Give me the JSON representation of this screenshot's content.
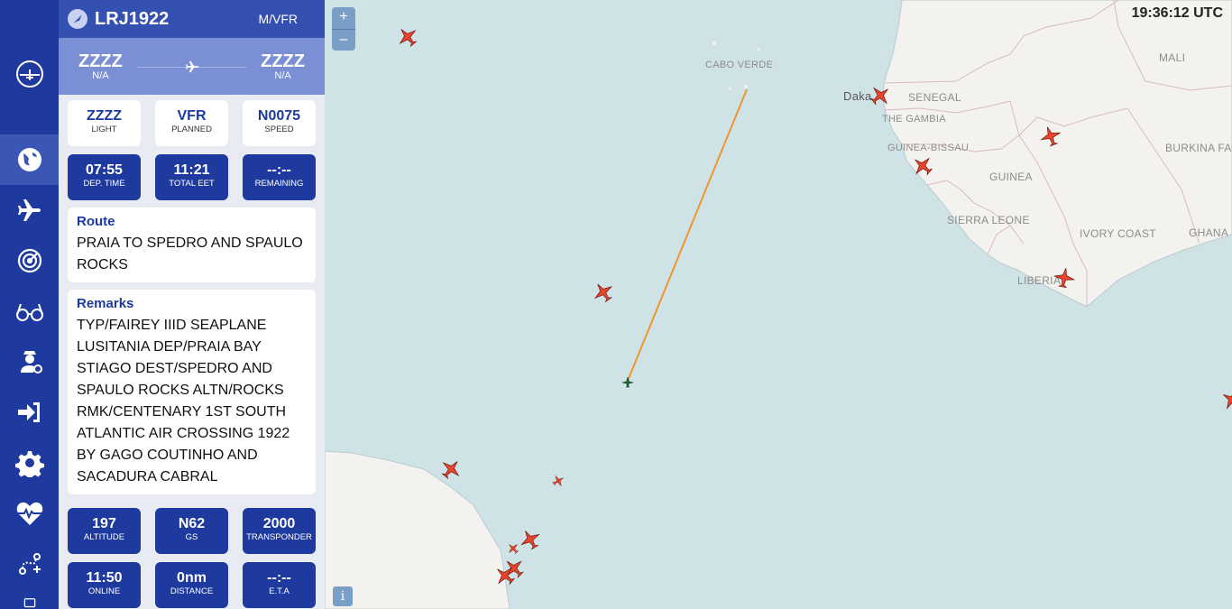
{
  "nav": {
    "items": [
      "logo-icon",
      "globe-icon",
      "airplane-icon",
      "radar-icon",
      "glasses-icon",
      "pilot-icon",
      "login-icon",
      "gear-icon",
      "heart-pulse-icon",
      "route-icon"
    ],
    "active": "globe-icon"
  },
  "flight": {
    "callsign": "LRJ1922",
    "rules": "M/VFR",
    "departure": {
      "code": "ZZZZ",
      "name": "N/A"
    },
    "arrival": {
      "code": "ZZZZ",
      "name": "N/A"
    },
    "row1": [
      {
        "value": "ZZZZ",
        "label": "LIGHT"
      },
      {
        "value": "VFR",
        "label": "PLANNED"
      },
      {
        "value": "N0075",
        "label": "SPEED"
      }
    ],
    "row2": [
      {
        "value": "07:55",
        "label": "DEP. TIME"
      },
      {
        "value": "11:21",
        "label": "TOTAL EET"
      },
      {
        "value": "--:--",
        "label": "REMAINING"
      }
    ],
    "route_title": "Route",
    "route_text": "PRAIA TO SPEDRO AND SPAULO ROCKS",
    "remarks_title": "Remarks",
    "remarks_text": "TYP/FAIREY IIID SEAPLANE LUSITANIA DEP/PRAIA BAY STIAGO DEST/SPEDRO AND SPAULO ROCKS ALTN/ROCKS RMK/CENTENARY 1ST SOUTH ATLANTIC AIR CROSSING 1922 BY GAGO COUTINHO AND SACADURA CABRAL",
    "row3": [
      {
        "value": "197",
        "label": "ALTITUDE"
      },
      {
        "value": "N62",
        "label": "GS"
      },
      {
        "value": "2000",
        "label": "TRANSPONDER"
      }
    ],
    "row4": [
      {
        "value": "11:50",
        "label": "ONLINE"
      },
      {
        "value": "0nm",
        "label": "DISTANCE"
      },
      {
        "value": "--:--",
        "label": "E.T.A"
      }
    ]
  },
  "map": {
    "clock": "19:36:12 UTC",
    "zoom_in": "+",
    "zoom_out": "–",
    "info": "i",
    "labels": {
      "cabo_verde": "CABO VERDE",
      "dakar": "Daka",
      "senegal": "SENEGAL",
      "the_gambia": "THE GAMBIA",
      "mali": "MALI",
      "guinea_bissau": "GUINEA-BISSAU",
      "burkina_faso": "BURKINA FASO",
      "guinea": "GUINEA",
      "sierra_leone": "SIERRA LEONE",
      "ivory_coast": "IVORY COAST",
      "ghana": "GHANA",
      "liberia": "LIBERIA"
    },
    "colors": {
      "ocean": "#cfe3e6",
      "land": "#f4f2ee",
      "border": "#d8b9c7",
      "route": "#f0962e",
      "aircraft": "#e8452c",
      "selected": "#1f6b3a"
    }
  }
}
